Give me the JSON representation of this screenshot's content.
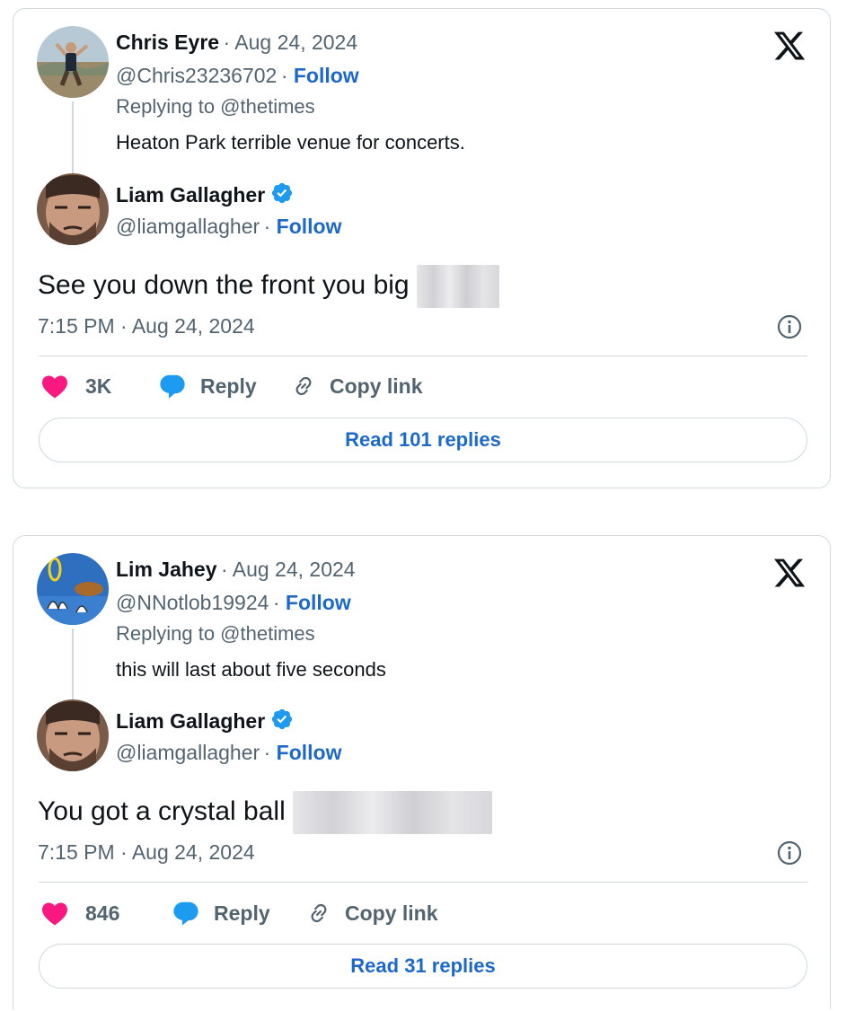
{
  "tweets": [
    {
      "reply_to_tweet": {
        "name": "Chris Eyre",
        "date": "Aug 24, 2024",
        "handle": "@Chris23236702",
        "follow_label": "Follow",
        "replying_to": "Replying to @thetimes",
        "text": "Heaton Park terrible venue for concerts."
      },
      "main_tweet": {
        "name": "Liam Gallagher",
        "handle": "@liamgallagher",
        "follow_label": "Follow",
        "text": "See you down the front you big",
        "time": "7:15 PM · Aug 24, 2024"
      },
      "actions": {
        "likes": "3K",
        "reply_label": "Reply",
        "copy_link_label": "Copy link"
      },
      "read_replies_label": "Read 101 replies"
    },
    {
      "reply_to_tweet": {
        "name": "Lim Jahey",
        "date": "Aug 24, 2024",
        "handle": "@NNotlob19924",
        "follow_label": "Follow",
        "replying_to": "Replying to @thetimes",
        "text": "this will last about five seconds"
      },
      "main_tweet": {
        "name": "Liam Gallagher",
        "handle": "@liamgallagher",
        "follow_label": "Follow",
        "text": "You got a crystal ball",
        "time": "7:15 PM · Aug 24, 2024"
      },
      "actions": {
        "likes": "846",
        "reply_label": "Reply",
        "copy_link_label": "Copy link"
      },
      "read_replies_label": "Read 31 replies"
    }
  ],
  "colors": {
    "like": "#f91880",
    "reply": "#1d9bf0",
    "link": "#1d69c9",
    "verified": "#1d9bf0",
    "muted": "#536471",
    "border": "#cfd9de"
  },
  "icons": [
    "x-logo-icon",
    "heart-icon",
    "reply-bubble-icon",
    "link-chain-icon",
    "info-icon",
    "verified-badge-icon"
  ]
}
